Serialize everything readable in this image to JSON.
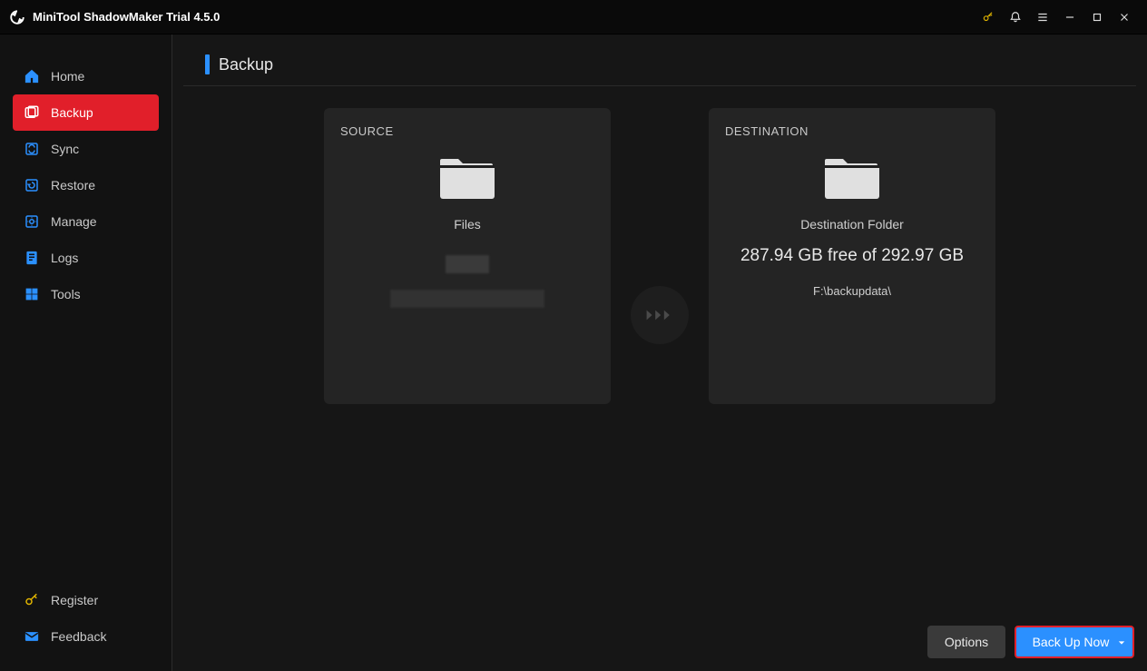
{
  "app": {
    "title": "MiniTool ShadowMaker Trial 4.5.0"
  },
  "sidebar": {
    "items": [
      {
        "label": "Home"
      },
      {
        "label": "Backup"
      },
      {
        "label": "Sync"
      },
      {
        "label": "Restore"
      },
      {
        "label": "Manage"
      },
      {
        "label": "Logs"
      },
      {
        "label": "Tools"
      }
    ],
    "bottom": [
      {
        "label": "Register"
      },
      {
        "label": "Feedback"
      }
    ]
  },
  "page": {
    "title": "Backup"
  },
  "source": {
    "title": "SOURCE",
    "caption": "Files"
  },
  "destination": {
    "title": "DESTINATION",
    "caption": "Destination Folder",
    "space": "287.94 GB free of 292.97 GB",
    "path": "F:\\backupdata\\"
  },
  "buttons": {
    "options": "Options",
    "backup_now": "Back Up Now"
  }
}
